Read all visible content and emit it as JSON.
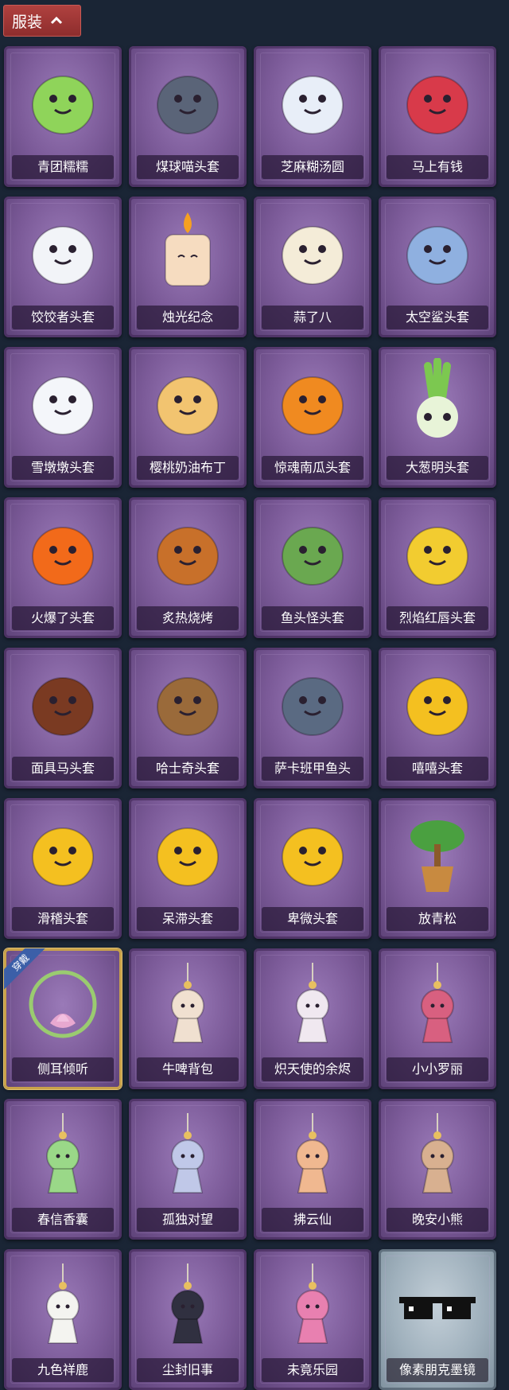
{
  "header": {
    "title": "服装",
    "accent_color": "#a83a3a"
  },
  "items": [
    {
      "label": "青团糯糯",
      "icon": "green-dumpling-icon",
      "color": "#8fd45a"
    },
    {
      "label": "煤球喵头套",
      "icon": "cat-head-icon",
      "color": "#5a6478"
    },
    {
      "label": "芝麻糊汤圆",
      "icon": "rice-ball-icon",
      "color": "#e8eef8"
    },
    {
      "label": "马上有钱",
      "icon": "red-horse-icon",
      "color": "#d83a4a"
    },
    {
      "label": "饺饺者头套",
      "icon": "dumpling-cloud-icon",
      "color": "#f2f4f8"
    },
    {
      "label": "烛光纪念",
      "icon": "candle-icon",
      "color": "#f6dcc0"
    },
    {
      "label": "蒜了八",
      "icon": "garlic-icon",
      "color": "#f4ecd8"
    },
    {
      "label": "太空鲨头套",
      "icon": "shark-head-icon",
      "color": "#8fb0e0"
    },
    {
      "label": "雪墩墩头套",
      "icon": "snowman-head-icon",
      "color": "#f4f6fa"
    },
    {
      "label": "樱桃奶油布丁",
      "icon": "pudding-icon",
      "color": "#f2c470"
    },
    {
      "label": "惊魂南瓜头套",
      "icon": "pumpkin-icon",
      "color": "#f08a20"
    },
    {
      "label": "大葱明头套",
      "icon": "scallion-icon",
      "color": "#7cc850"
    },
    {
      "label": "火爆了头套",
      "icon": "fireball-icon",
      "color": "#f26a1a"
    },
    {
      "label": "炙热烧烤",
      "icon": "bbq-meat-icon",
      "color": "#c8702a"
    },
    {
      "label": "鱼头怪头套",
      "icon": "fish-head-icon",
      "color": "#6aa850"
    },
    {
      "label": "烈焰红唇头套",
      "icon": "yellow-mouse-icon",
      "color": "#f2cc30"
    },
    {
      "label": "面具马头套",
      "icon": "horse-mask-icon",
      "color": "#7a3a22"
    },
    {
      "label": "哈士奇头套",
      "icon": "husky-head-icon",
      "color": "#9a6a3a"
    },
    {
      "label": "萨卡班甲鱼头",
      "icon": "sacabambaspis-icon",
      "color": "#5a6a82"
    },
    {
      "label": "嘻嘻头套",
      "icon": "grin-emoji-icon",
      "color": "#f4c020"
    },
    {
      "label": "滑稽头套",
      "icon": "smirk-emoji-icon",
      "color": "#f4c020"
    },
    {
      "label": "呆滞头套",
      "icon": "blank-emoji-icon",
      "color": "#f4c020"
    },
    {
      "label": "卑微头套",
      "icon": "humble-emoji-icon",
      "color": "#f4c020"
    },
    {
      "label": "放青松",
      "icon": "potted-pine-icon",
      "color": "#4aa040"
    },
    {
      "label": "侧耳倾听",
      "icon": "lotus-wreath-icon",
      "color": "#e8a8d0",
      "badge": "穿戴",
      "equipped": true
    },
    {
      "label": "牛啤背包",
      "icon": "cow-beer-icon",
      "color": "#f0e0d0"
    },
    {
      "label": "炽天使的余烬",
      "icon": "angel-doll-icon",
      "color": "#f0e8f0"
    },
    {
      "label": "小小罗丽",
      "icon": "girl-doll-icon",
      "color": "#d86080"
    },
    {
      "label": "春信香囊",
      "icon": "sachet-icon",
      "color": "#9ad888"
    },
    {
      "label": "孤独对望",
      "icon": "silver-doll-icon",
      "color": "#c0c8e8"
    },
    {
      "label": "拂云仙",
      "icon": "fairy-charm-icon",
      "color": "#f0b890"
    },
    {
      "label": "晚安小熊",
      "icon": "bear-charm-icon",
      "color": "#d8b090"
    },
    {
      "label": "九色祥鹿",
      "icon": "deer-charm-icon",
      "color": "#f4f4f0"
    },
    {
      "label": "尘封旧事",
      "icon": "dark-doll-icon",
      "color": "#303040"
    },
    {
      "label": "未竟乐园",
      "icon": "clown-doll-icon",
      "color": "#e880b0"
    },
    {
      "label": "像素朋克墨镜",
      "icon": "pixel-sunglasses-icon",
      "color": "#111111",
      "grey": true
    }
  ]
}
